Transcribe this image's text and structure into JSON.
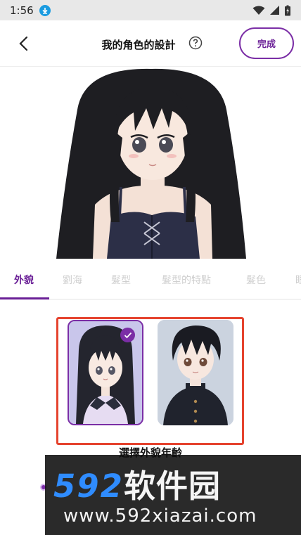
{
  "status_bar": {
    "time": "1:56"
  },
  "header": {
    "title": "我的角色的設計",
    "done_label": "完成"
  },
  "tabs": [
    {
      "label": "外貌",
      "active": true
    },
    {
      "label": "劉海",
      "active": false
    },
    {
      "label": "髮型",
      "active": false
    },
    {
      "label": "髮型的特點",
      "active": false
    },
    {
      "label": "髮色",
      "active": false
    },
    {
      "label": "眼",
      "active": false
    }
  ],
  "options": [
    {
      "name": "female",
      "selected": true
    },
    {
      "name": "male",
      "selected": false
    }
  ],
  "select_label": "選擇外貌年齡",
  "watermark": {
    "num": "592",
    "cn": "软件园",
    "url": "www.592xiazai.com"
  },
  "colors": {
    "accent": "#7b2ea6",
    "highlight": "#e5432e",
    "watermark_blue": "#2f8cff"
  }
}
